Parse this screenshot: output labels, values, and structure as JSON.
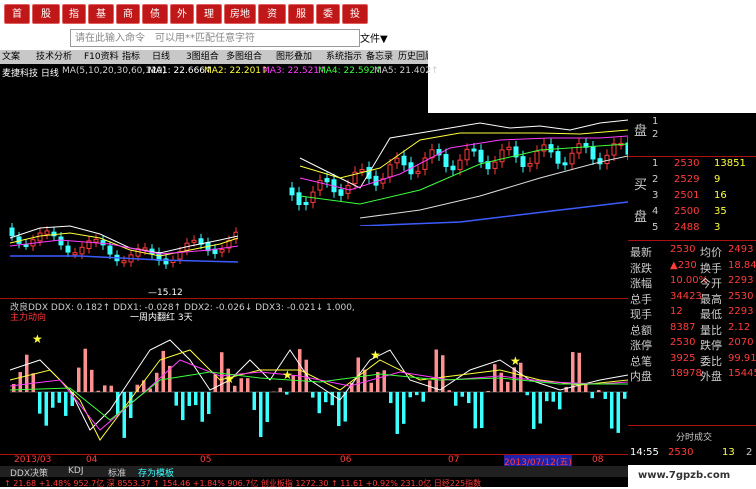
{
  "nav": [
    "首页",
    "股票",
    "指数",
    "基金",
    "商品",
    "债券",
    "外汇",
    "理财",
    "房地产",
    "资讯",
    "服务",
    "委托",
    "投顾"
  ],
  "search": {
    "placeholder": "请在此输入命令　可以用**匹配任意字符"
  },
  "toolbar": {
    "menu_label": "文件▼"
  },
  "tools": [
    "文案",
    "技术分析",
    "F10资料",
    "指标",
    "日线",
    "3图组合",
    "多图组合",
    "图形叠加",
    "系统指示",
    "备忘录",
    "历史回顾"
  ],
  "stock": {
    "name": "麦捷科技 日线",
    "ma_text": "MA(5,10,20,30,60,120)",
    "ma1": "MA1: 22.666↑",
    "ma2": "MA2: 22.201↑",
    "ma3": "MA3: 22.521↑",
    "ma4": "MA4: 22.592↑",
    "ma5": "MA5: 21.402↑"
  },
  "price_low_label": "—15.12",
  "indicator": {
    "title": "改良DDX DDX: 0.182↑ DDX1: -0.028↑ DDX2: -0.026↓ DDX3: -0.021↓ 1.000,",
    "sub": "主力动向",
    "note": "一周内翻红 3天"
  },
  "axis_dates": [
    "2013/03",
    "04",
    "05",
    "06",
    "07",
    "2013/07/12(五)",
    "08"
  ],
  "quote": {
    "sell_label": "盘",
    "buy_label": "买",
    "buy_rows": [
      {
        "n": "1",
        "p": "2530",
        "v": "13851"
      },
      {
        "n": "2",
        "p": "2529",
        "v": "9"
      },
      {
        "n": "3",
        "p": "2501",
        "v": "16"
      },
      {
        "n": "4",
        "p": "2500",
        "v": "35"
      },
      {
        "n": "5",
        "p": "2488",
        "v": "3"
      }
    ],
    "stats": [
      [
        "最新",
        "2530",
        "均价",
        "2493"
      ],
      [
        "涨跌",
        "▲230",
        "换手",
        "18.84"
      ],
      [
        "涨幅",
        "10.00%",
        "今开",
        "2293"
      ],
      [
        "总手",
        "34423",
        "最高",
        "2530"
      ],
      [
        "现手",
        "12",
        "最低",
        "2293"
      ],
      [
        "总额",
        "8387",
        "量比",
        "2.12"
      ],
      [
        "涨停",
        "2530",
        "跌停",
        "2070"
      ],
      [
        "总笔",
        "3925",
        "委比",
        "99.91"
      ],
      [
        "内盘",
        "18978",
        "外盘",
        "15445"
      ]
    ],
    "trade_label": "分时成交",
    "trade_row": {
      "t": "14:55",
      "p": "2530",
      "v": "13",
      "s": "2"
    }
  },
  "bottom_tabs": [
    "DDX决策",
    "KDJ",
    "标准",
    "存为模板"
  ],
  "ticker": "↑ 21.68 +1.48% 952.7亿 深 8553.37 ↑ 154.46 +1.84% 906.7亿 创业板指 1272.30 ↑ 11.61 +0.92% 231.0亿 日经225指数",
  "watermark": "www.7gpzb.com"
}
